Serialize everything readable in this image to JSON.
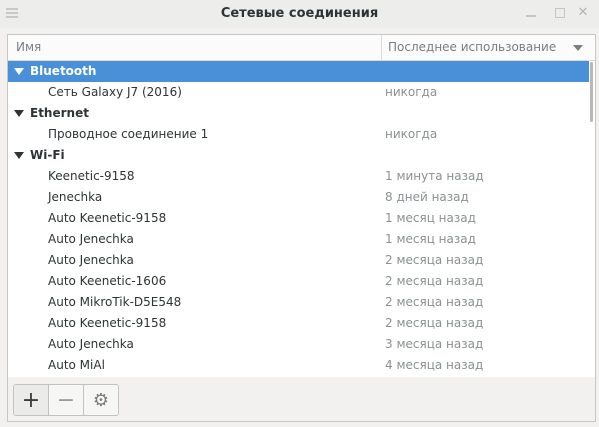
{
  "window": {
    "title": "Сетевые соединения"
  },
  "header": {
    "col_name": "Имя",
    "col_last_used": "Последнее использование"
  },
  "groups": [
    {
      "name": "Bluetooth",
      "selected": true,
      "items": [
        {
          "name": "Сеть Galaxy J7 (2016)",
          "last_used": "никогда"
        }
      ]
    },
    {
      "name": "Ethernet",
      "selected": false,
      "items": [
        {
          "name": "Проводное соединение 1",
          "last_used": "никогда"
        }
      ]
    },
    {
      "name": "Wi-Fi",
      "selected": false,
      "items": [
        {
          "name": "Keenetic-9158",
          "last_used": "1 минута назад"
        },
        {
          "name": "Jenechka",
          "last_used": "8 дней назад"
        },
        {
          "name": "Auto Keenetic-9158",
          "last_used": "1 месяц назад"
        },
        {
          "name": "Auto Jenechka",
          "last_used": "1 месяц назад"
        },
        {
          "name": "Auto Jenechka",
          "last_used": "2 месяца назад"
        },
        {
          "name": "Auto Keenetic-1606",
          "last_used": "2 месяца назад"
        },
        {
          "name": "Auto MikroTik-D5E548",
          "last_used": "2 месяца назад"
        },
        {
          "name": "Auto Keenetic-9158",
          "last_used": "2 месяца назад"
        },
        {
          "name": "Auto Jenechka",
          "last_used": "3 месяца назад"
        },
        {
          "name": "Auto MiAl",
          "last_used": "4 месяца назад"
        }
      ]
    }
  ],
  "toolbar": {
    "add_icon": "plus-icon",
    "remove_icon": "minus-icon",
    "settings_icon": "gear-icon",
    "accent_color": "#4a90d9"
  }
}
